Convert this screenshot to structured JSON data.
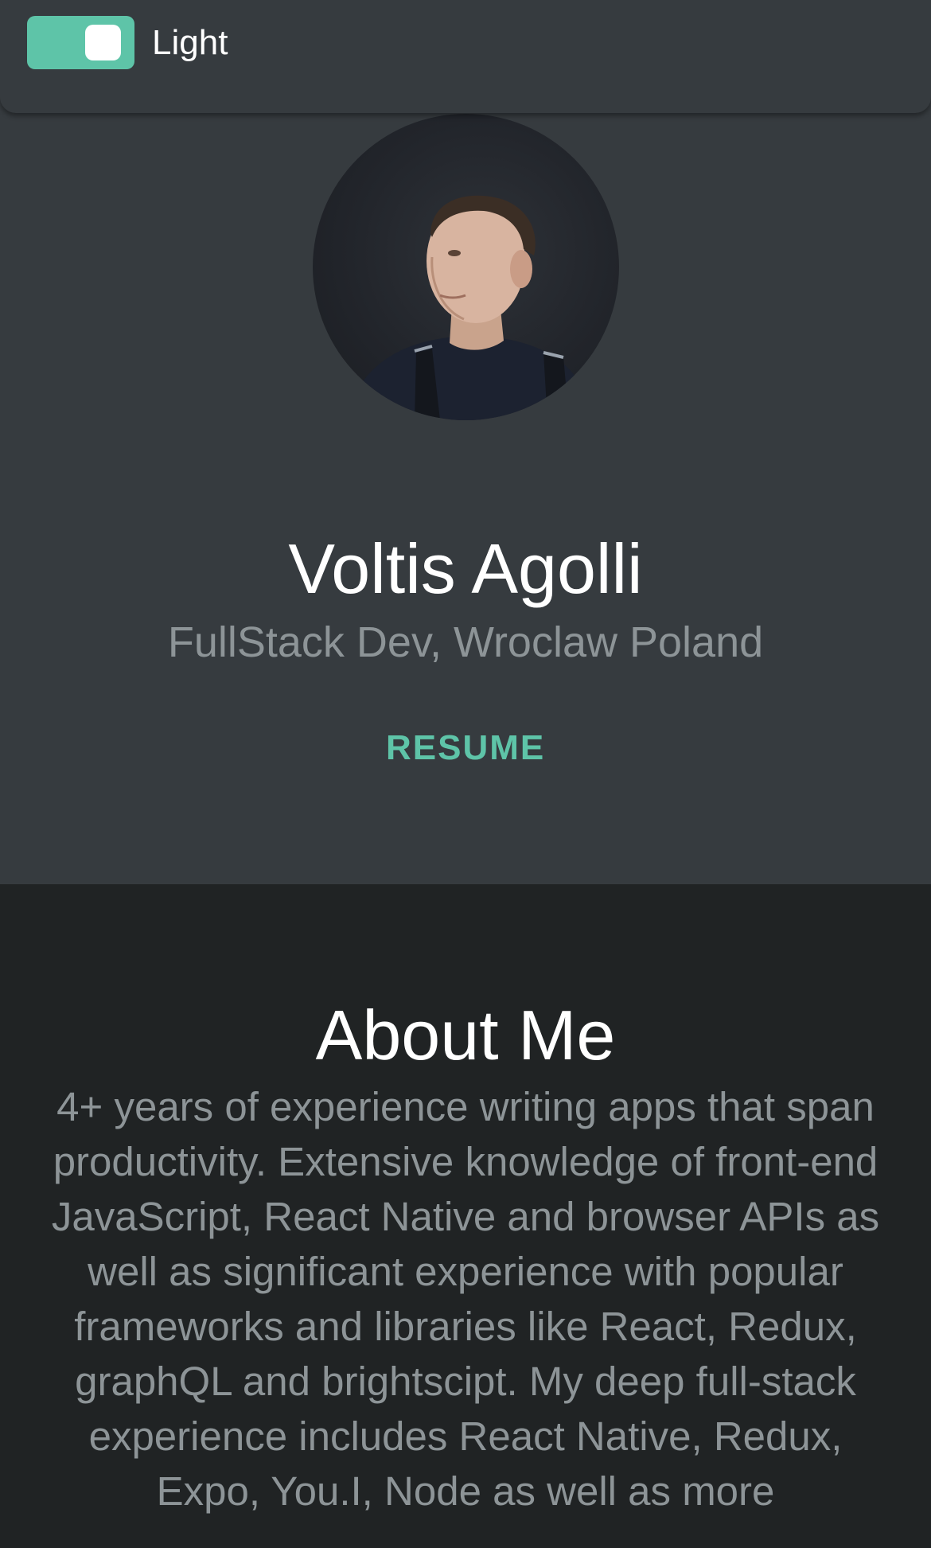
{
  "theme": {
    "accent": "#5ec4a8",
    "muted_text": "#8d9497",
    "hero_background": "#363b3f",
    "about_background": "#202324"
  },
  "header": {
    "toggle_label": "Light",
    "toggle_on": true
  },
  "profile": {
    "name": "Voltis Agolli",
    "subtitle": "FullStack Dev, Wroclaw Poland",
    "resume_label": "RESUME"
  },
  "about": {
    "title": "About Me",
    "text": "4+ years of experience writing apps that span productivity. Extensive knowledge of front-end JavaScript, React Native and browser APIs as well as significant experience with popular frameworks and libraries like React, Redux, graphQL and brightscipt. My deep full-stack experience includes React Native, Redux, Expo, You.I, Node as well as more"
  }
}
